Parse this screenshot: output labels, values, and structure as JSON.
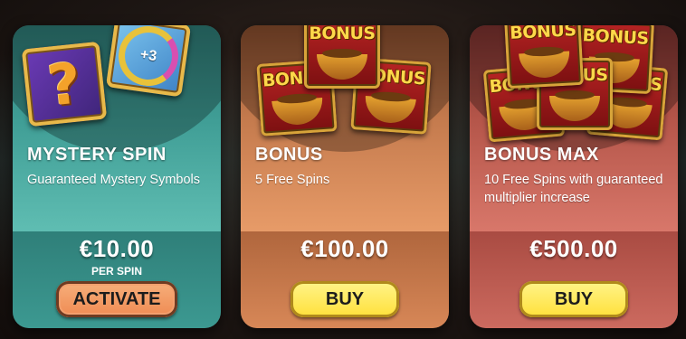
{
  "offers": [
    {
      "title": "MYSTERY SPIN",
      "description": "Guaranteed Mystery Symbols",
      "price": "€10.00",
      "price_note": "PER SPIN",
      "button_label": "ACTIVATE",
      "button_color": "#ef8a52",
      "card_color": "#3f9d95",
      "art": {
        "mystery_symbol": "?",
        "spins_badge": "+3"
      }
    },
    {
      "title": "BONUS",
      "description": "5 Free Spins",
      "price": "€100.00",
      "button_label": "BUY",
      "button_color": "#ffe03a",
      "card_color": "#d78757",
      "art": {
        "bonus_word": "BONUS"
      }
    },
    {
      "title": "BONUS MAX",
      "description": "10 Free Spins with guaranteed multiplier increase",
      "price": "€500.00",
      "button_label": "BUY",
      "button_color": "#ffe03a",
      "card_color": "#cc6a5f",
      "art": {
        "bonus_word": "BONUS"
      }
    }
  ]
}
